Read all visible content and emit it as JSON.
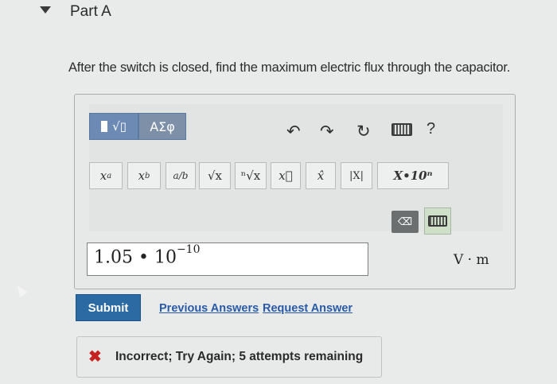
{
  "part": {
    "title": "Part A"
  },
  "question": {
    "text": "After the switch is closed, find the maximum electric flux through the capacitor."
  },
  "toolbar": {
    "templates_glyph": "√▯",
    "symbols_label": "ΑΣφ",
    "help_label": "?",
    "keys": [
      {
        "name": "superscript",
        "base": "x",
        "mod": "a",
        "mod_type": "sup"
      },
      {
        "name": "subscript",
        "base": "x",
        "mod": "b",
        "mod_type": "sub"
      },
      {
        "name": "fraction",
        "label": "a/b"
      },
      {
        "name": "sqrt",
        "label": "√x"
      },
      {
        "name": "nth-root",
        "label": "ⁿ√x"
      },
      {
        "name": "vector",
        "label": "x⃗"
      },
      {
        "name": "unit-vector",
        "label": "x̂"
      },
      {
        "name": "abs",
        "label": "|X|"
      },
      {
        "name": "sci-notation",
        "label": "X•10ⁿ"
      }
    ],
    "delete_label": "⌫"
  },
  "answer": {
    "mantissa": "1.05 • 10",
    "exponent": "−10",
    "unit": "V · m"
  },
  "actions": {
    "submit_label": "Submit",
    "previous_answers_label": "Previous Answers",
    "request_answer_label": "Request Answer"
  },
  "feedback": {
    "icon": "x-icon",
    "message": "Incorrect; Try Again; 5 attempts remaining",
    "color": "#c62222"
  },
  "colors": {
    "submit": "#2b6aa3",
    "templates": "#6d8ab5",
    "link": "#2a5aa5"
  }
}
